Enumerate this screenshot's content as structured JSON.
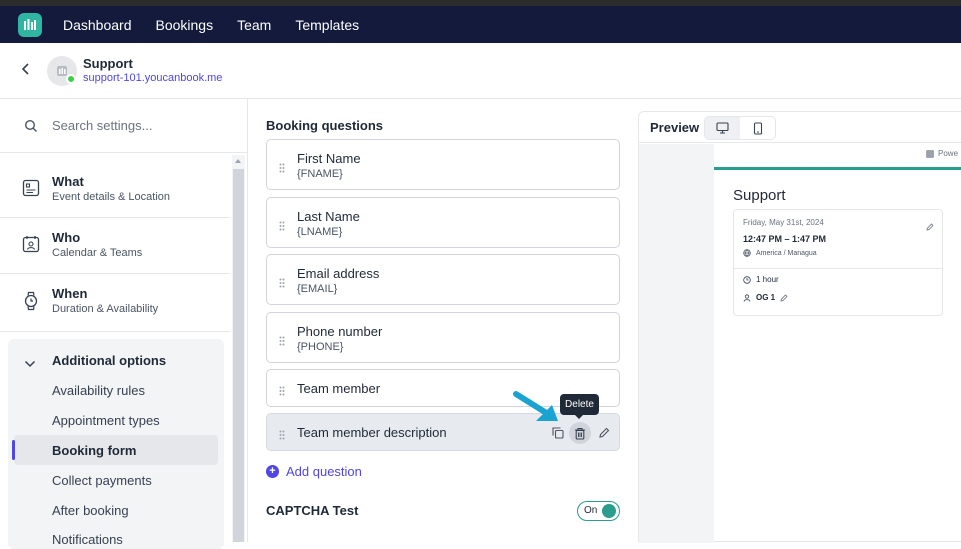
{
  "nav": {
    "items": [
      "Dashboard",
      "Bookings",
      "Team",
      "Templates"
    ]
  },
  "header": {
    "title": "Support",
    "link": "support-101.youcanbook.me"
  },
  "sidebar": {
    "search_placeholder": "Search settings...",
    "sections": [
      {
        "title": "What",
        "subtitle": "Event details & Location",
        "icon": "event-details-icon"
      },
      {
        "title": "Who",
        "subtitle": "Calendar & Teams",
        "icon": "calendar-teams-icon"
      },
      {
        "title": "When",
        "subtitle": "Duration & Availability",
        "icon": "watch-icon"
      }
    ],
    "additional": {
      "title": "Additional options",
      "items": [
        "Availability rules",
        "Appointment types",
        "Booking form",
        "Collect payments",
        "After booking",
        "Notifications"
      ],
      "active": "Booking form"
    }
  },
  "main": {
    "title": "Booking questions",
    "questions": [
      {
        "label": "First Name",
        "token": "{FNAME}"
      },
      {
        "label": "Last Name",
        "token": "{LNAME}"
      },
      {
        "label": "Email address",
        "token": "{EMAIL}"
      },
      {
        "label": "Phone number",
        "token": "{PHONE}"
      },
      {
        "label": "Team member",
        "token": ""
      },
      {
        "label": "Team member description",
        "token": ""
      }
    ],
    "tooltip": "Delete",
    "add_question": "Add question",
    "captcha_label": "CAPTCHA Test",
    "captcha_toggle": "On"
  },
  "preview": {
    "label": "Preview",
    "powered": "Powe",
    "title": "Support",
    "date": "Friday, May 31st, 2024",
    "time": "12:47 PM – 1:47 PM",
    "timezone": "America / Managua",
    "duration": "1 hour",
    "who": "OG 1"
  },
  "colors": {
    "nav_bg": "#131a3c",
    "accent": "#4f46e5",
    "teal": "#2a9d8f",
    "annotation_arrow": "#1aa3d1"
  }
}
